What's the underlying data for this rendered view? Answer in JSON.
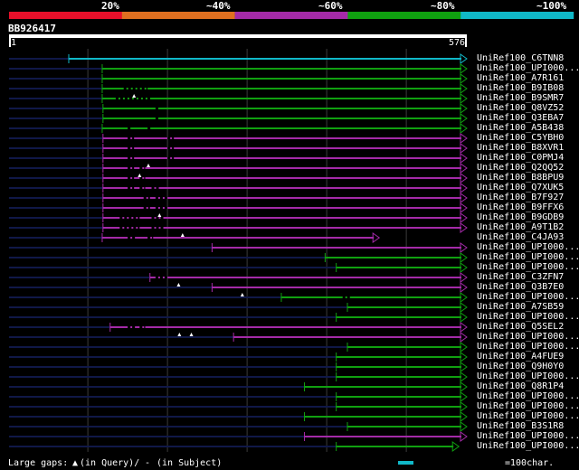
{
  "legend": {
    "labels": [
      "20%",
      "~40%",
      "~60%",
      "~80%",
      "~100%"
    ],
    "colors": [
      "#e8102a",
      "#e07020",
      "#a42aa8",
      "#10a010",
      "#10b8c8"
    ]
  },
  "query": {
    "id": "BB926417",
    "start": "1",
    "end": "576",
    "length": 576
  },
  "hits": [
    {
      "name": "UniRef100_C6TNN8",
      "start": 76,
      "end": 576,
      "identity": 5,
      "gaps": []
    },
    {
      "name": "UniRef100_UPI000...",
      "start": 118,
      "end": 576,
      "identity": 4,
      "gaps": []
    },
    {
      "name": "UniRef100_A7R161",
      "start": 118,
      "end": 576,
      "identity": 4,
      "gaps": []
    },
    {
      "name": "UniRef100_B9IB08",
      "start": 118,
      "end": 576,
      "identity": 4,
      "gaps": [
        [
          145,
          175
        ]
      ],
      "qmarks": [
        158
      ]
    },
    {
      "name": "UniRef100_B9SMR7",
      "start": 118,
      "end": 576,
      "identity": 4,
      "gaps": [
        [
          135,
          180
        ]
      ]
    },
    {
      "name": "UniRef100_Q8VZ52",
      "start": 119,
      "end": 576,
      "identity": 4,
      "gaps": [
        [
          185,
          190
        ]
      ]
    },
    {
      "name": "UniRef100_Q3EBA7",
      "start": 119,
      "end": 576,
      "identity": 4,
      "gaps": [
        [
          185,
          190
        ]
      ]
    },
    {
      "name": "UniRef100_A5B438",
      "start": 118,
      "end": 576,
      "identity": 4,
      "gaps": [
        [
          150,
          155
        ],
        [
          175,
          180
        ]
      ]
    },
    {
      "name": "UniRef100_C5YBH0",
      "start": 119,
      "end": 576,
      "identity": 3,
      "gaps": [
        [
          150,
          158
        ],
        [
          200,
          208
        ]
      ]
    },
    {
      "name": "UniRef100_B8XVR1",
      "start": 119,
      "end": 576,
      "identity": 3,
      "gaps": [
        [
          150,
          158
        ],
        [
          200,
          208
        ]
      ]
    },
    {
      "name": "UniRef100_C0PMJ4",
      "start": 119,
      "end": 576,
      "identity": 3,
      "gaps": [
        [
          150,
          158
        ],
        [
          200,
          208
        ]
      ],
      "qmarks": [
        176
      ]
    },
    {
      "name": "UniRef100_Q2QQ52",
      "start": 119,
      "end": 576,
      "identity": 3,
      "gaps": [
        [
          150,
          158
        ],
        [
          165,
          172
        ]
      ],
      "qmarks": [
        165
      ]
    },
    {
      "name": "UniRef100_B8BPU9",
      "start": 119,
      "end": 576,
      "identity": 3,
      "gaps": [
        [
          150,
          158
        ],
        [
          165,
          172
        ]
      ]
    },
    {
      "name": "UniRef100_Q7XUK5",
      "start": 119,
      "end": 576,
      "identity": 3,
      "gaps": [
        [
          150,
          158
        ],
        [
          165,
          172
        ],
        [
          180,
          190
        ]
      ]
    },
    {
      "name": "UniRef100_B7F927",
      "start": 119,
      "end": 576,
      "identity": 3,
      "gaps": [
        [
          170,
          178
        ],
        [
          185,
          200
        ]
      ]
    },
    {
      "name": "UniRef100_B9FFX6",
      "start": 119,
      "end": 576,
      "identity": 3,
      "gaps": [
        [
          170,
          178
        ],
        [
          185,
          200
        ]
      ],
      "qmarks": [
        190
      ]
    },
    {
      "name": "UniRef100_B9GDB9",
      "start": 119,
      "end": 576,
      "identity": 3,
      "gaps": [
        [
          140,
          165
        ],
        [
          180,
          195
        ]
      ]
    },
    {
      "name": "UniRef100_A9T1B2",
      "start": 119,
      "end": 576,
      "identity": 3,
      "gaps": [
        [
          140,
          165
        ],
        [
          180,
          195
        ]
      ],
      "qmarks": [
        219
      ]
    },
    {
      "name": "UniRef100_C4JA93",
      "start": 118,
      "end": 466,
      "identity": 3,
      "gaps": [
        [
          150,
          160
        ],
        [
          175,
          182
        ]
      ]
    },
    {
      "name": "UniRef100_UPI000...",
      "start": 256,
      "end": 576,
      "identity": 3,
      "gaps": []
    },
    {
      "name": "UniRef100_UPI000...",
      "start": 398,
      "end": 576,
      "identity": 4,
      "gaps": []
    },
    {
      "name": "UniRef100_UPI000...",
      "start": 412,
      "end": 576,
      "identity": 4,
      "gaps": []
    },
    {
      "name": "UniRef100_C3ZFN7",
      "start": 178,
      "end": 576,
      "identity": 3,
      "gaps": [
        [
          185,
          200
        ]
      ],
      "qmarks": [
        214
      ]
    },
    {
      "name": "UniRef100_Q3B7E0",
      "start": 256,
      "end": 576,
      "identity": 3,
      "gaps": [],
      "qmarks": [
        294
      ]
    },
    {
      "name": "UniRef100_UPI000...",
      "start": 343,
      "end": 576,
      "identity": 4,
      "gaps": [
        [
          420,
          430
        ]
      ]
    },
    {
      "name": "UniRef100_A7SB59",
      "start": 426,
      "end": 576,
      "identity": 4,
      "gaps": []
    },
    {
      "name": "UniRef100_UPI000...",
      "start": 412,
      "end": 576,
      "identity": 4,
      "gaps": []
    },
    {
      "name": "UniRef100_Q5SEL2",
      "start": 128,
      "end": 576,
      "identity": 3,
      "gaps": [
        [
          150,
          160
        ],
        [
          165,
          172
        ]
      ],
      "qmarks": [
        215,
        230
      ]
    },
    {
      "name": "UniRef100_UPI000...",
      "start": 283,
      "end": 576,
      "identity": 3,
      "gaps": []
    },
    {
      "name": "UniRef100_UPI000...",
      "start": 426,
      "end": 576,
      "identity": 4,
      "gaps": []
    },
    {
      "name": "UniRef100_A4FUE9",
      "start": 412,
      "end": 576,
      "identity": 4,
      "gaps": []
    },
    {
      "name": "UniRef100_Q9H0Y0",
      "start": 412,
      "end": 576,
      "identity": 4,
      "gaps": []
    },
    {
      "name": "UniRef100_UPI000...",
      "start": 412,
      "end": 576,
      "identity": 4,
      "gaps": []
    },
    {
      "name": "UniRef100_Q8R1P4",
      "start": 372,
      "end": 576,
      "identity": 4,
      "gaps": []
    },
    {
      "name": "UniRef100_UPI000...",
      "start": 412,
      "end": 576,
      "identity": 4,
      "gaps": []
    },
    {
      "name": "UniRef100_UPI000...",
      "start": 412,
      "end": 576,
      "identity": 4,
      "gaps": []
    },
    {
      "name": "UniRef100_UPI000...",
      "start": 372,
      "end": 576,
      "identity": 4,
      "gaps": []
    },
    {
      "name": "UniRef100_B3S1R8",
      "start": 426,
      "end": 576,
      "identity": 4,
      "gaps": []
    },
    {
      "name": "UniRef100_UPI000...",
      "start": 372,
      "end": 576,
      "identity": 3,
      "gaps": []
    },
    {
      "name": "UniRef100_UPI000...",
      "start": 412,
      "end": 566,
      "identity": 4,
      "gaps": []
    }
  ],
  "footer": {
    "gaps_prefix": "Large gaps:",
    "in_query": "(in Query)/",
    "in_subject": "(in Subject)",
    "scale_label": "=100char."
  },
  "grid_ticks": [
    100,
    200,
    300,
    400,
    500
  ]
}
